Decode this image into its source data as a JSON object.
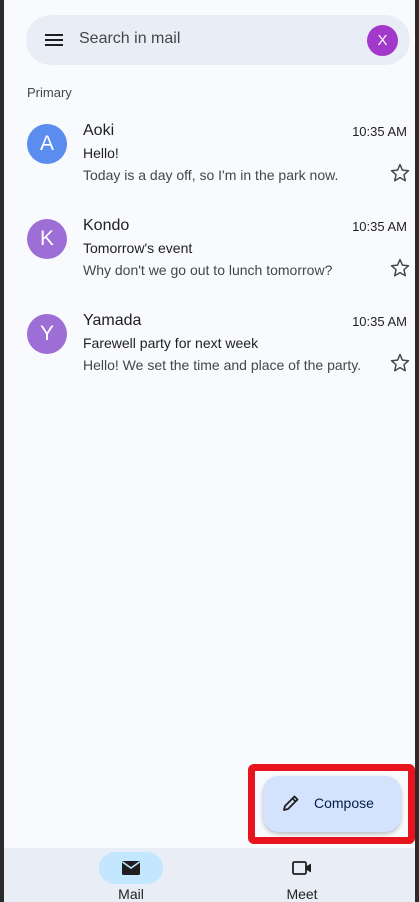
{
  "search": {
    "placeholder": "Search in mail",
    "avatar_letter": "X",
    "avatar_color": "#a239ca"
  },
  "section": {
    "label": "Primary"
  },
  "emails": [
    {
      "avatar_letter": "A",
      "avatar_color": "#5b8def",
      "sender": "Aoki",
      "time": "10:35 AM",
      "subject": "Hello!",
      "snippet": "Today is a day off, so I'm in the park now.",
      "starred": false
    },
    {
      "avatar_letter": "K",
      "avatar_color": "#9c6ed6",
      "sender": "Kondo",
      "time": "10:35 AM",
      "subject": "Tomorrow's event",
      "snippet": "Why don't we go out to lunch tomorrow?",
      "starred": false
    },
    {
      "avatar_letter": "Y",
      "avatar_color": "#9c6ed6",
      "sender": "Yamada",
      "time": "10:35 AM",
      "subject": "Farewell party for next week",
      "snippet": "Hello! We set the time and place of the party.",
      "starred": false
    }
  ],
  "compose": {
    "label": "Compose",
    "icon": "pencil-icon",
    "highlight_color": "#e8141d"
  },
  "bottom_nav": [
    {
      "label": "Mail",
      "icon": "mail-icon",
      "active": true
    },
    {
      "label": "Meet",
      "icon": "video-icon",
      "active": false
    }
  ]
}
